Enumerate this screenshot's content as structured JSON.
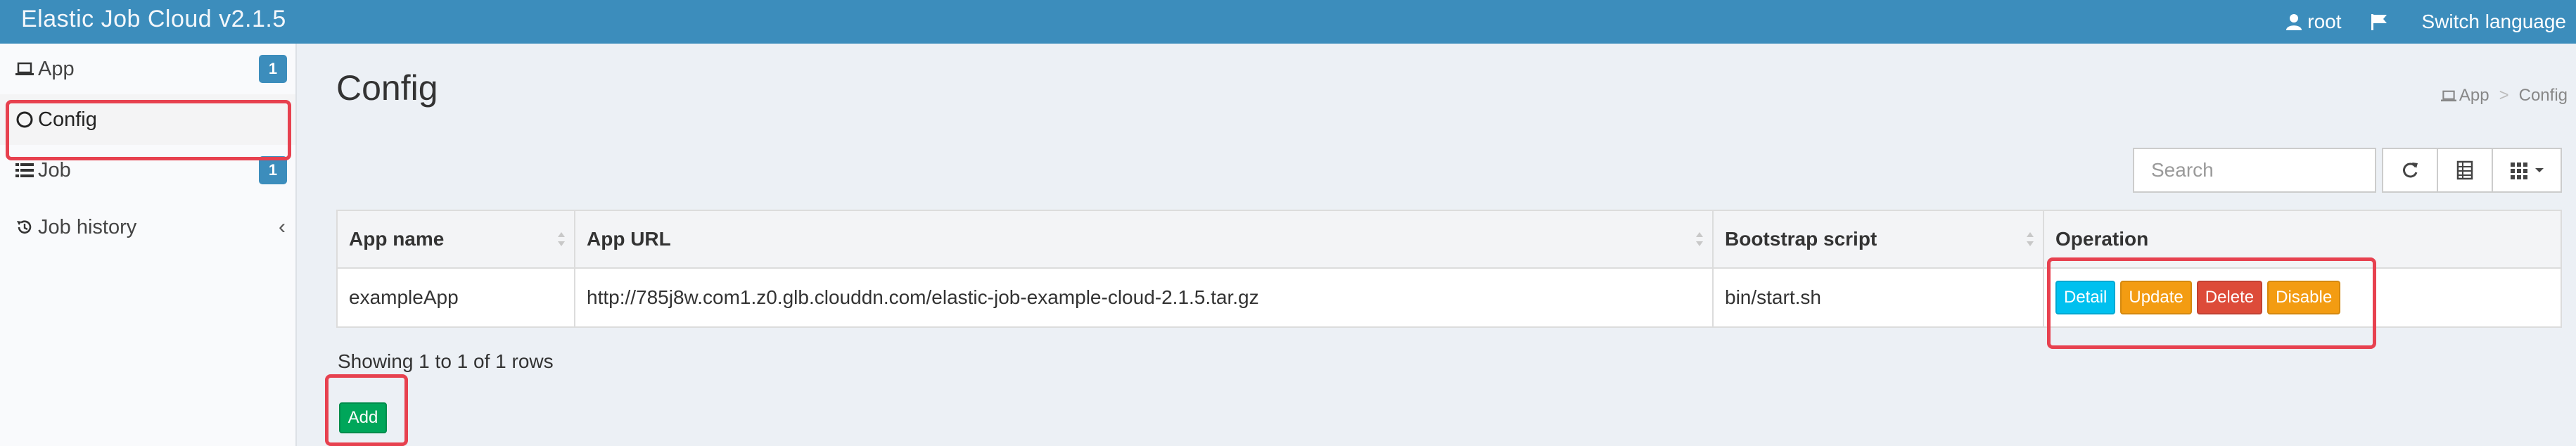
{
  "header": {
    "brand": "Elastic Job Cloud v2.1.5",
    "user": "root",
    "switch_language": "Switch language",
    "user_icon": "user-icon",
    "flag_icon": "flag-icon"
  },
  "sidebar": {
    "items": [
      {
        "label": "App",
        "icon": "laptop-icon",
        "badge": "1"
      },
      {
        "label": "Config",
        "icon": "circle-icon"
      },
      {
        "label": "Job",
        "icon": "tasks-icon",
        "badge": "1"
      },
      {
        "label": "Job history",
        "icon": "history-icon"
      }
    ]
  },
  "content": {
    "title": "Config",
    "breadcrumb": [
      "App",
      "Config"
    ]
  },
  "toolbar": {
    "search_placeholder": "Search"
  },
  "table": {
    "headers": [
      "App name",
      "App URL",
      "Bootstrap script",
      "Operation"
    ],
    "rows": [
      {
        "app_name": "exampleApp",
        "app_url": "http://785j8w.com1.z0.glb.clouddn.com/elastic-job-example-cloud-2.1.5.tar.gz",
        "bootstrap_script": "bin/start.sh",
        "ops": [
          "Detail",
          "Update",
          "Delete",
          "Disable"
        ]
      }
    ]
  },
  "pagination": {
    "showing": "Showing 1 to 1 of 1 rows"
  },
  "actions": {
    "add": "Add"
  },
  "colors": {
    "header": "#3c8dbc",
    "highlight": "#e7414f",
    "detail": "#00c0ef",
    "update": "#f39c12",
    "delete": "#dd4b39",
    "add": "#00a65a"
  }
}
